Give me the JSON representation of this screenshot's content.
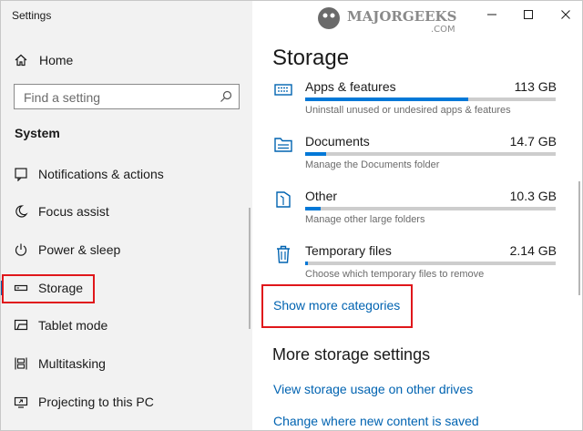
{
  "window": {
    "title": "Settings",
    "logo_text": "MAJORGEEKS",
    "logo_sub": ".COM"
  },
  "sidebar": {
    "home_label": "Home",
    "search_placeholder": "Find a setting",
    "section_title": "System",
    "items": [
      {
        "label": "Notifications & actions",
        "icon": "notification-icon"
      },
      {
        "label": "Focus assist",
        "icon": "moon-icon"
      },
      {
        "label": "Power & sleep",
        "icon": "power-icon"
      },
      {
        "label": "Storage",
        "icon": "drive-icon",
        "selected": true
      },
      {
        "label": "Tablet mode",
        "icon": "tablet-icon"
      },
      {
        "label": "Multitasking",
        "icon": "multitasking-icon"
      },
      {
        "label": "Projecting to this PC",
        "icon": "project-icon"
      }
    ]
  },
  "main": {
    "heading": "Storage",
    "categories": [
      {
        "name": "Apps & features",
        "size": "113 GB",
        "desc": "Uninstall unused or undesired apps & features",
        "usage_fraction": 0.65,
        "icon": "apps-icon"
      },
      {
        "name": "Documents",
        "size": "14.7 GB",
        "desc": "Manage the Documents folder",
        "usage_fraction": 0.085,
        "icon": "folder-icon"
      },
      {
        "name": "Other",
        "size": "10.3 GB",
        "desc": "Manage other large folders",
        "usage_fraction": 0.06,
        "icon": "other-icon"
      },
      {
        "name": "Temporary files",
        "size": "2.14 GB",
        "desc": "Choose which temporary files to remove",
        "usage_fraction": 0.012,
        "icon": "trash-icon"
      }
    ],
    "show_more": "Show more categories",
    "more_heading": "More storage settings",
    "links": [
      "View storage usage on other drives",
      "Change where new content is saved"
    ]
  },
  "colors": {
    "accent": "#0078d7",
    "link": "#0063b1",
    "highlight": "#e0171b",
    "sidebar_bg": "#f2f2f2"
  }
}
